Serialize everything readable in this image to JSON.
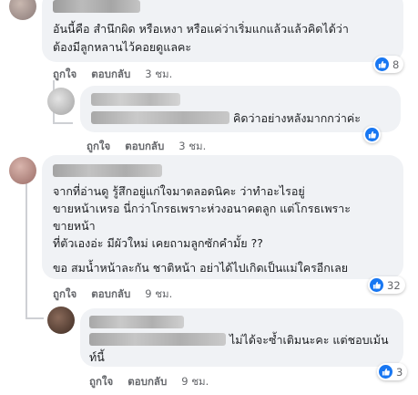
{
  "comments": [
    {
      "text_lines": [
        "อันนี้คือ สำนึกผิด หรือเหงา หรือแค่ว่าเริ่มแกแล้วแล้วคิดได้ว่า",
        "ต้องมีลูกหลานไว้คอยดูแลคะ"
      ],
      "like_label": "ถูกใจ",
      "reply_label": "ตอบกลับ",
      "time": "3 ชม.",
      "reaction_count": "8"
    },
    {
      "text_line": "คิดว่าอย่างหลังมากกว่าค่ะ",
      "like_label": "ถูกใจ",
      "reply_label": "ตอบกลับ",
      "time": "3 ชม."
    },
    {
      "text_lines": [
        "จากที่อ่านดู รู้สึกอยู่แก่ใจมาตลอดนิคะ ว่าทำอะไรอยู่",
        "ขายหน้าเหรอ นี่กว่าโกรธเพราะห่วงอนาคตลูก แต่โกรธเพราะ",
        "ขายหน้า",
        "ที่ตัวเองอ่ะ มีผัวใหม่ เคยถามลูกซักคำมั้ย ??",
        "",
        "ขอ สมน้ำหน้าละกัน ชาติหน้า อย่าได้ไปเกิดเป็นแม่ใครอีกเลย"
      ],
      "like_label": "ถูกใจ",
      "reply_label": "ตอบกลับ",
      "time": "9 ชม.",
      "reaction_count": "32"
    },
    {
      "text_lines": [
        "ไม่ได้จะซ้ำเติมนะคะ แต่ชอบเม้น",
        "ท์นี้"
      ],
      "like_label": "ถูกใจ",
      "reply_label": "ตอบกลับ",
      "time": "9 ชม.",
      "reaction_count": "3"
    }
  ],
  "colors": {
    "bubble": "#f0f2f5",
    "meta_text": "#65676b",
    "like_blue": "#1877f2"
  },
  "icons": [
    "like-thumb-icon",
    "avatar",
    "blurred-name"
  ]
}
